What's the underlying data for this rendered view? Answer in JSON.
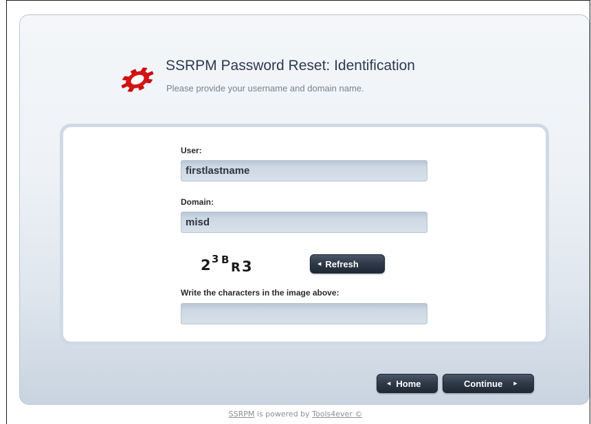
{
  "header": {
    "title": "SSRPM Password Reset: Identification",
    "subtitle": "Please provide your username and domain name."
  },
  "form": {
    "user_label": "User:",
    "user_value": "firstlastname",
    "domain_label": "Domain:",
    "domain_value": "misd",
    "captcha_text": "2³BR3",
    "refresh_label": "Refresh",
    "captcha_prompt": "Write the characters in the image above:",
    "captcha_value": ""
  },
  "nav": {
    "home_label": "Home",
    "continue_label": "Continue"
  },
  "footer": {
    "product_link": "SSRPM",
    "powered_text": " is powered by ",
    "vendor_link": "Tools4ever ©"
  },
  "colors": {
    "logo_red": "#d41414",
    "button_dark": "#2e3947",
    "field_bg": "#cdd8e3"
  },
  "icons": {
    "logo": "gear-icon",
    "back": "left-arrow-icon",
    "forward": "right-arrow-icon"
  }
}
